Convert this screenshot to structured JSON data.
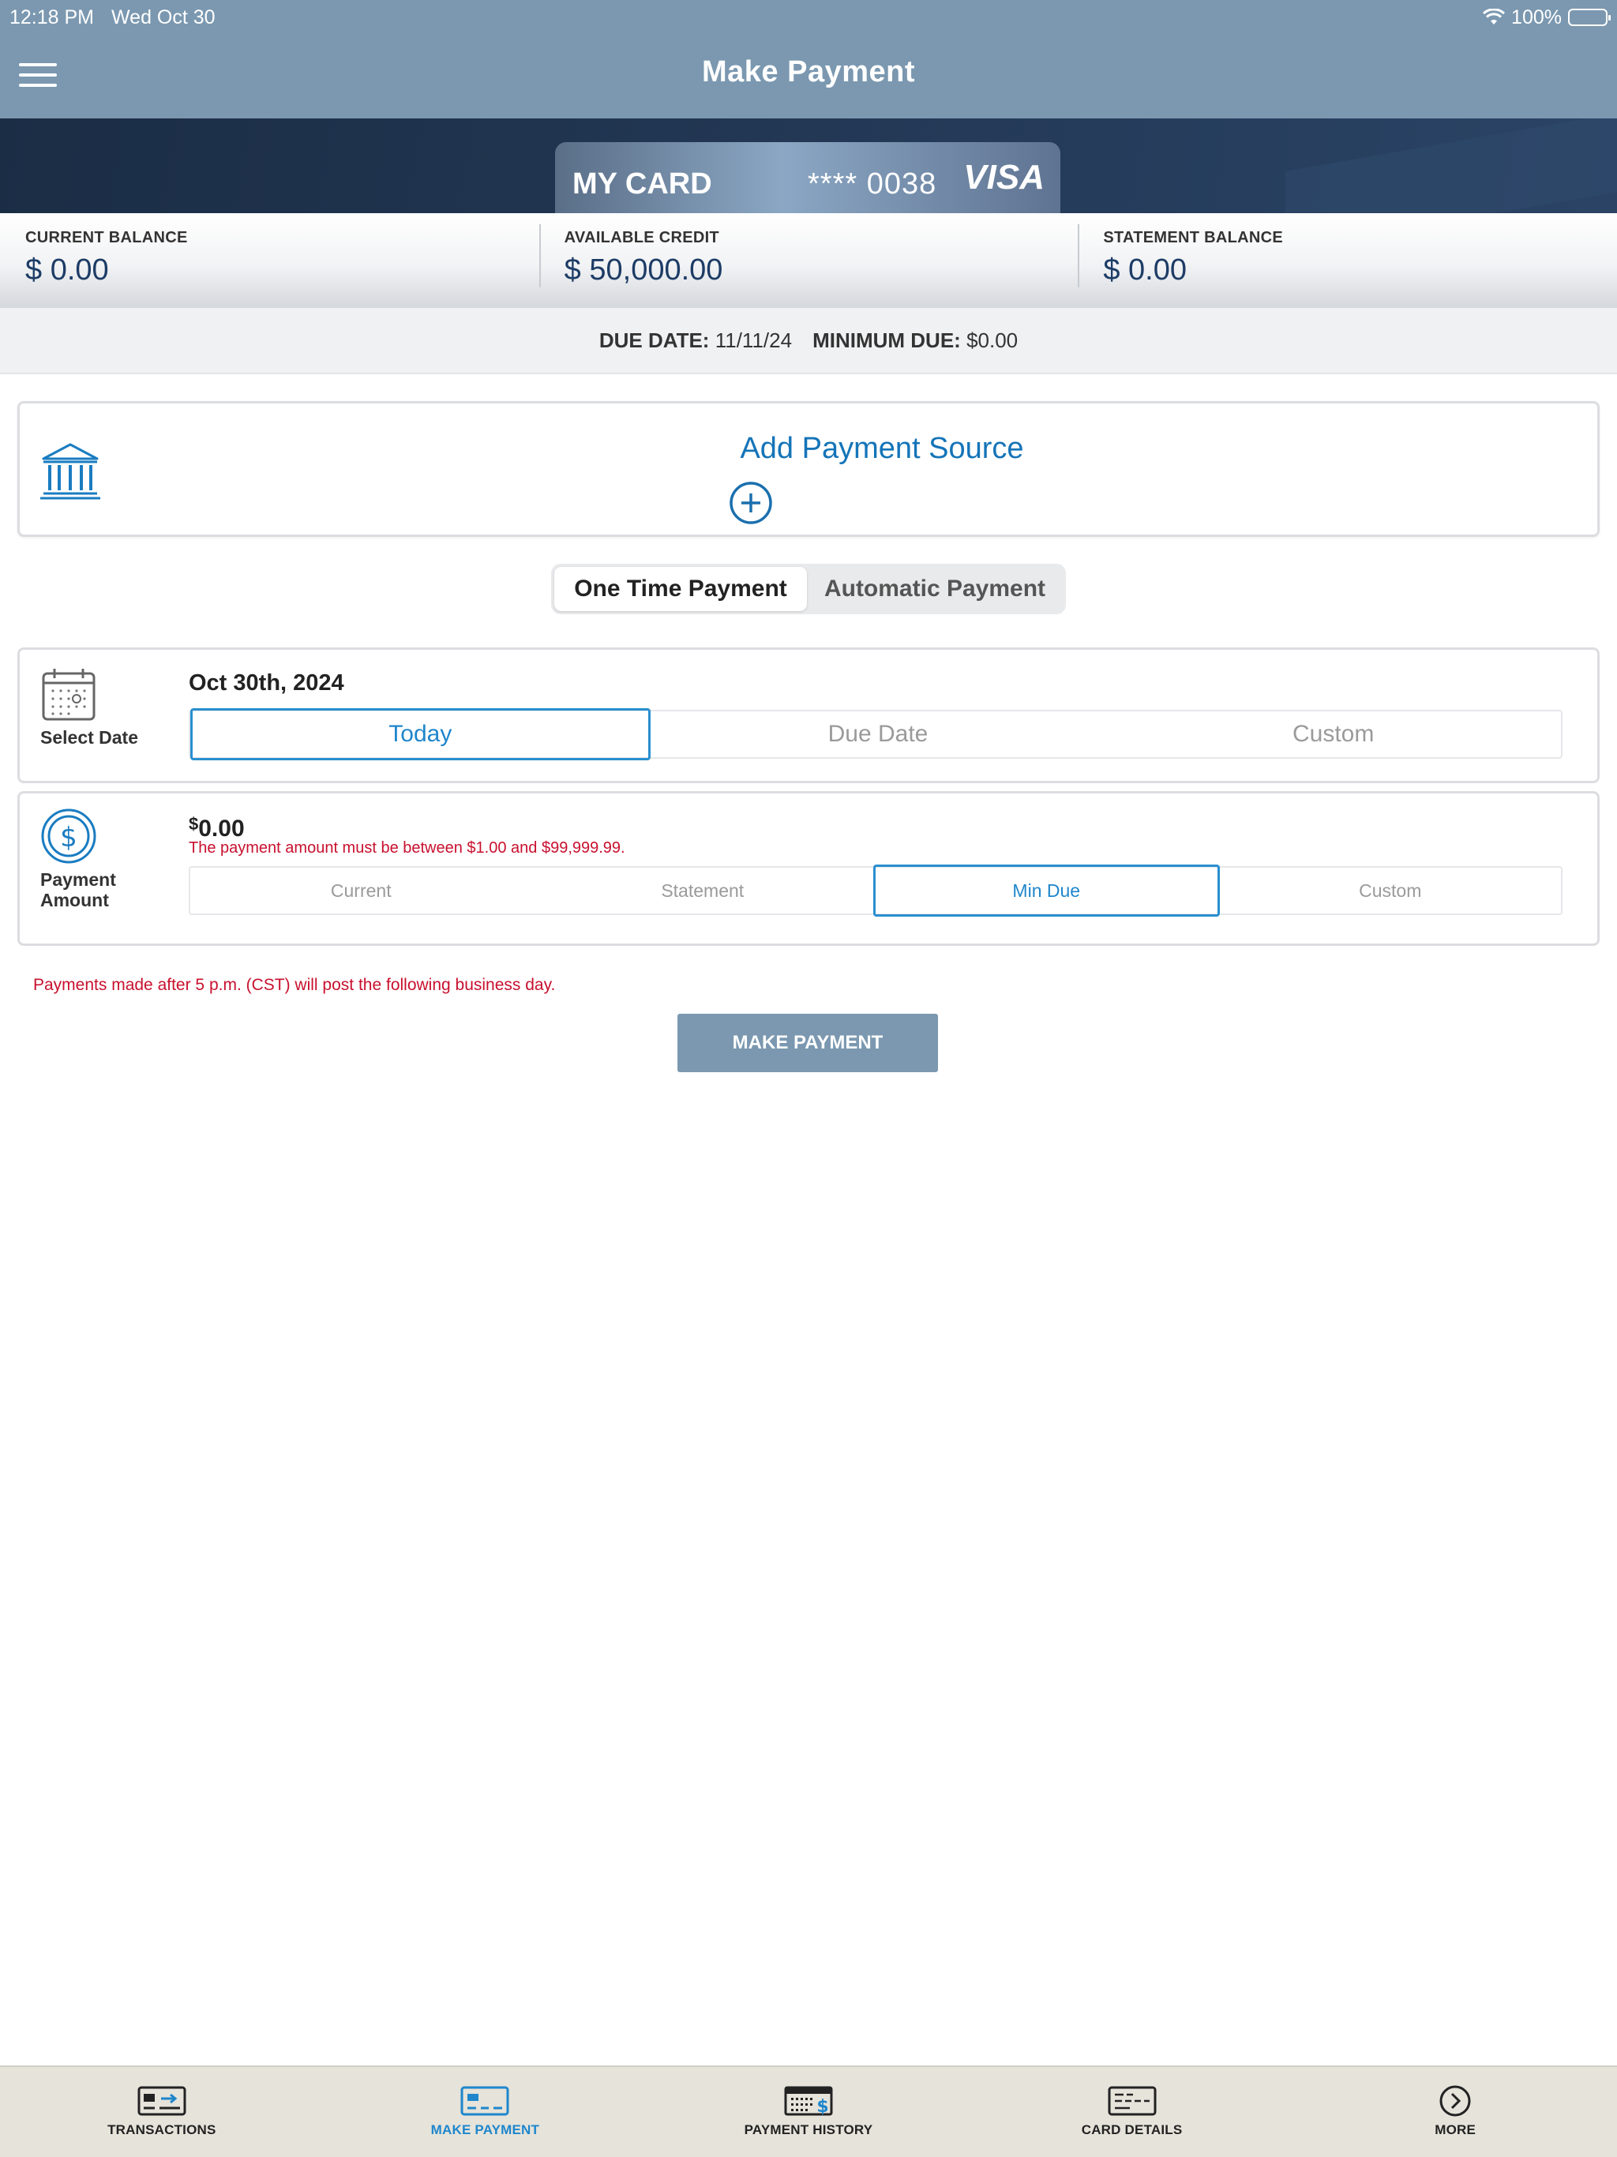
{
  "status_bar": {
    "time": "12:18 PM",
    "date": "Wed Oct 30",
    "battery": "100%"
  },
  "header": {
    "title": "Make Payment",
    "menu_icon": "hamburger-menu-icon"
  },
  "card": {
    "name": "MY CARD",
    "number": "**** 0038",
    "brand": "VISA"
  },
  "balances": [
    {
      "label": "CURRENT BALANCE",
      "value": "$ 0.00"
    },
    {
      "label": "AVAILABLE CREDIT",
      "value": "$ 50,000.00"
    },
    {
      "label": "STATEMENT BALANCE",
      "value": "$ 0.00"
    }
  ],
  "due": {
    "due_date_label": "DUE DATE:",
    "due_date_value": "11/11/24",
    "min_due_label": "MINIMUM DUE:",
    "min_due_value": "$0.00"
  },
  "payment_source": {
    "title": "Add Payment Source",
    "icon": "bank-icon",
    "add_icon": "plus-circle-icon"
  },
  "payment_type": {
    "options": [
      "One Time Payment",
      "Automatic Payment"
    ],
    "selected": "One Time Payment"
  },
  "date_section": {
    "label": "Select Date",
    "value": "Oct 30th, 2024",
    "options": [
      "Today",
      "Due Date",
      "Custom"
    ],
    "selected": "Today",
    "icon": "calendar-icon"
  },
  "amount_section": {
    "label_line1": "Payment",
    "label_line2": "Amount",
    "currency_symbol": "$",
    "value": "0.00",
    "error": "The payment amount must be between $1.00 and $99,999.99.",
    "options": [
      "Current",
      "Statement",
      "Min Due",
      "Custom"
    ],
    "selected": "Min Due",
    "icon": "dollar-circle-icon"
  },
  "notice": "Payments made after 5 p.m. (CST) will post the following business day.",
  "submit_label": "MAKE PAYMENT",
  "tabs": [
    {
      "label": "TRANSACTIONS",
      "icon": "transactions-icon"
    },
    {
      "label": "MAKE PAYMENT",
      "icon": "make-payment-icon",
      "active": true
    },
    {
      "label": "PAYMENT HISTORY",
      "icon": "payment-history-icon"
    },
    {
      "label": "CARD DETAILS",
      "icon": "card-details-icon"
    },
    {
      "label": "MORE",
      "icon": "more-chevron-icon"
    }
  ],
  "colors": {
    "header": "#7b98b0",
    "accent": "#1f86cc",
    "error": "#c8102e",
    "balance_text": "#1d3c66",
    "tabbar": "#e5e3da"
  }
}
